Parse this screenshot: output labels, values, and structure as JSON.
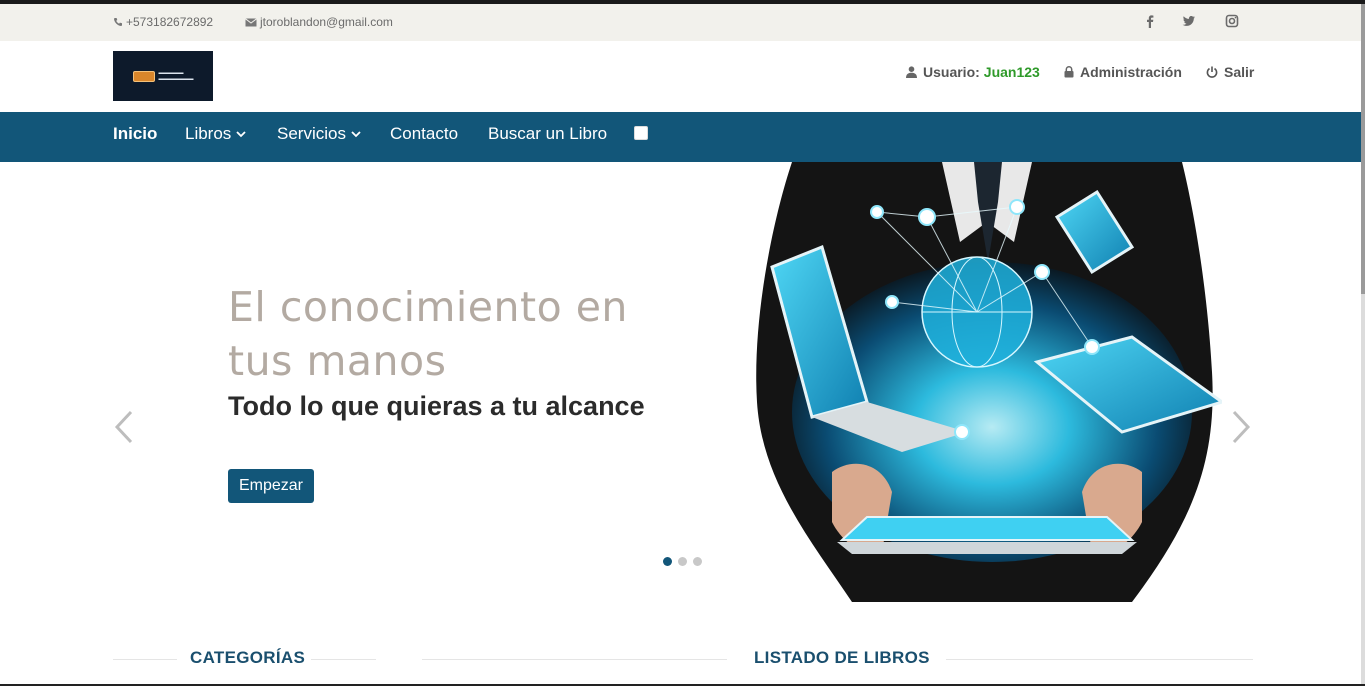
{
  "topbar": {
    "phone": "+573182672892",
    "email": "jtoroblandon@gmail.com",
    "social": [
      "facebook-icon",
      "twitter-icon",
      "instagram-icon"
    ]
  },
  "header": {
    "user_label": "Usuario:",
    "user_name": "Juan123",
    "admin_label": "Administración",
    "logout_label": "Salir"
  },
  "nav": {
    "items": [
      {
        "label": "Inicio",
        "active": true
      },
      {
        "label": "Libros",
        "dropdown": true
      },
      {
        "label": "Servicios",
        "dropdown": true
      },
      {
        "label": "Contacto"
      },
      {
        "label": "Buscar un Libro"
      }
    ]
  },
  "hero": {
    "title": "El conocimiento en tus manos",
    "subtitle": "Todo lo que quieras a tu alcance",
    "button": "Empezar",
    "slides": 3,
    "active_slide": 1
  },
  "sections": {
    "categories": "CATEGORÍAS",
    "books": "LISTADO DE LIBROS"
  },
  "colors": {
    "nav_bg": "#125679",
    "topbar_bg": "#f2f1ec",
    "username": "#2f9a2a",
    "section_title": "#1a4f6e"
  }
}
